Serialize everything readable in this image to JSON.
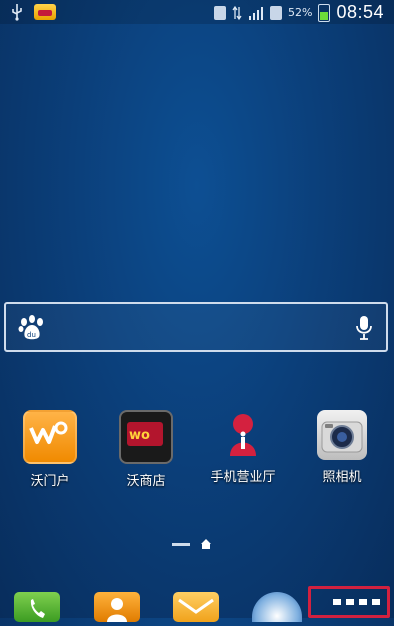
{
  "status_bar": {
    "time": "08:54",
    "battery_percent": "52%",
    "icons": [
      "usb-icon",
      "notification-app-icon",
      "alarm-icon",
      "data-arrows-icon",
      "signal-icon",
      "sim-icon",
      "battery-icon"
    ]
  },
  "search_bar": {
    "left_icon": "baidu-paw-icon",
    "right_icon": "microphone-icon"
  },
  "apps": [
    {
      "label": "沃门户",
      "icon": "wo-portal-icon"
    },
    {
      "label": "沃商店",
      "icon": "wo-store-icon"
    },
    {
      "label": "手机营业厅",
      "icon": "mobile-hall-icon"
    },
    {
      "label": "照相机",
      "icon": "camera-icon"
    }
  ],
  "dock": {
    "items": [
      "phone-icon",
      "contacts-icon",
      "messages-icon",
      "browser-icon",
      "apps-drawer-icon"
    ]
  },
  "colors": {
    "wallpaper": "#0b3f7a",
    "highlight_border": "#d2213f"
  }
}
